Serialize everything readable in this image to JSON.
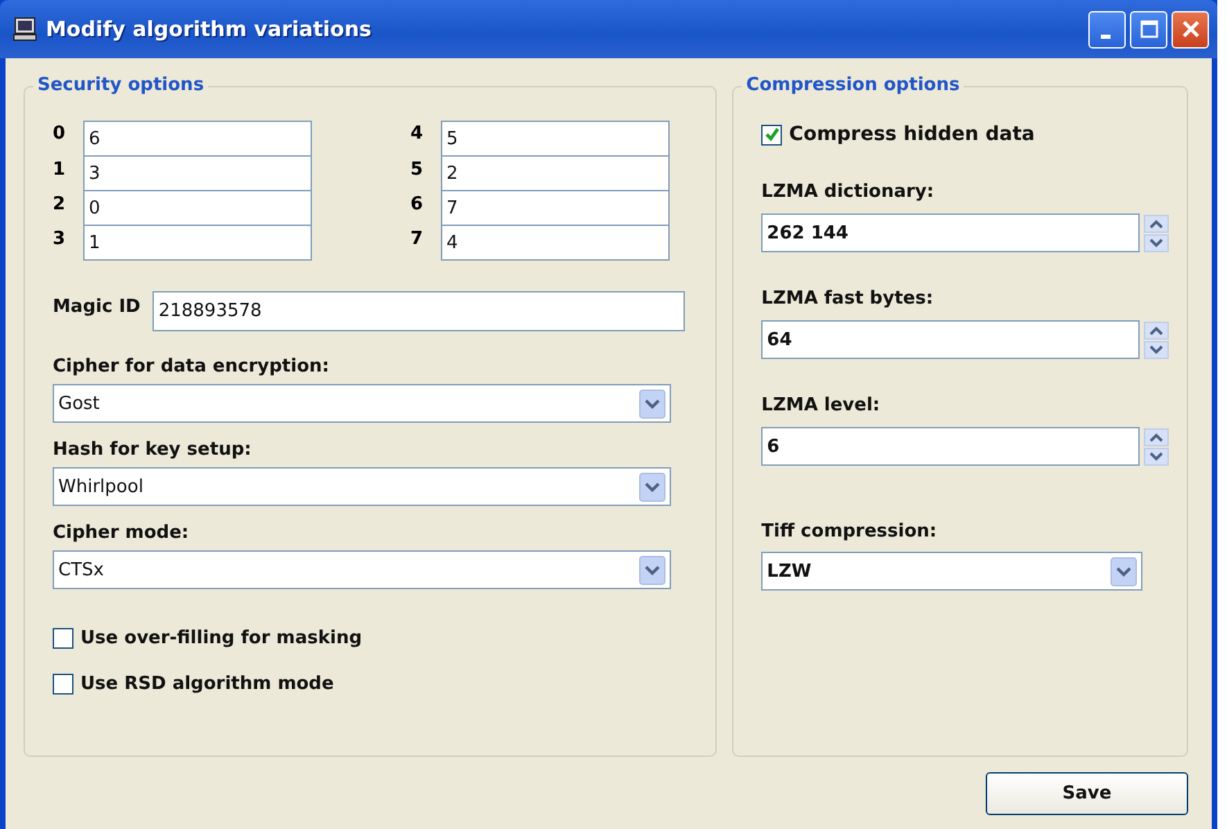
{
  "window": {
    "title": "Modify algorithm variations"
  },
  "security": {
    "title": "Security options",
    "mapping": [
      {
        "label": "0",
        "value": "6"
      },
      {
        "label": "1",
        "value": "3"
      },
      {
        "label": "2",
        "value": "0"
      },
      {
        "label": "3",
        "value": "1"
      },
      {
        "label": "4",
        "value": "5"
      },
      {
        "label": "5",
        "value": "2"
      },
      {
        "label": "6",
        "value": "7"
      },
      {
        "label": "7",
        "value": "4"
      }
    ],
    "magic_id": {
      "label": "Magic ID",
      "value": "218893578"
    },
    "dropdowns": [
      {
        "label": "Cipher for data encryption:",
        "value": "Gost"
      },
      {
        "label": "Hash for key setup:",
        "value": "Whirlpool"
      },
      {
        "label": "Cipher mode:",
        "value": "CTSx"
      }
    ],
    "checkboxes": [
      {
        "label": "Use over-filling for masking",
        "checked": false
      },
      {
        "label": "Use RSD algorithm mode",
        "checked": false
      }
    ]
  },
  "compression": {
    "title": "Compression options",
    "checkbox": {
      "label": "Compress hidden data",
      "checked": true
    },
    "spinners": [
      {
        "label": "LZMA dictionary:",
        "value": "262 144"
      },
      {
        "label": "LZMA fast bytes:",
        "value": "64"
      },
      {
        "label": "LZMA level:",
        "value": "6"
      }
    ],
    "dropdown": {
      "label": "Tiff compression:",
      "value": "LZW"
    }
  },
  "buttons": [
    "Save"
  ]
}
